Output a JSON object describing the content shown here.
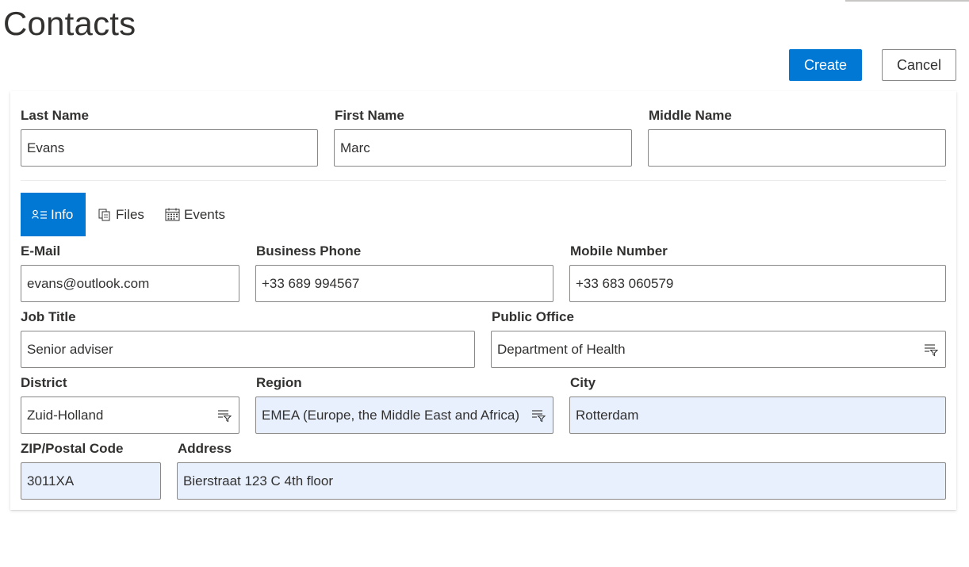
{
  "page": {
    "title": "Contacts"
  },
  "actions": {
    "create_label": "Create",
    "cancel_label": "Cancel"
  },
  "name_fields": {
    "last_name": {
      "label": "Last Name",
      "value": "Evans"
    },
    "first_name": {
      "label": "First Name",
      "value": "Marc"
    },
    "middle_name": {
      "label": "Middle Name",
      "value": ""
    }
  },
  "tabs": [
    {
      "label": "Info",
      "icon": "contact-info-icon",
      "active": true
    },
    {
      "label": "Files",
      "icon": "files-icon",
      "active": false
    },
    {
      "label": "Events",
      "icon": "calendar-icon",
      "active": false
    }
  ],
  "info": {
    "email": {
      "label": "E-Mail",
      "value": "evans@outlook.com"
    },
    "business_phone": {
      "label": "Business Phone",
      "value": "+33 689 994567"
    },
    "mobile_number": {
      "label": "Mobile Number",
      "value": "+33 683 060579"
    },
    "job_title": {
      "label": "Job Title",
      "value": "Senior adviser"
    },
    "public_office": {
      "label": "Public Office",
      "value": "Department of Health",
      "icon": "filter-list-icon"
    },
    "district": {
      "label": "District",
      "value": "Zuid-Holland",
      "icon": "filter-list-icon"
    },
    "region": {
      "label": "Region",
      "value": "EMEA (Europe, the Middle East and Africa)",
      "icon": "filter-list-icon"
    },
    "city": {
      "label": "City",
      "value": "Rotterdam"
    },
    "zip": {
      "label": "ZIP/Postal Code",
      "value": "3011XA"
    },
    "address": {
      "label": "Address",
      "value": "Bierstraat 123 C 4th floor"
    }
  },
  "colors": {
    "accent": "#0078d4",
    "autofill_bg": "#e8f0fe",
    "border": "#8a8886"
  }
}
